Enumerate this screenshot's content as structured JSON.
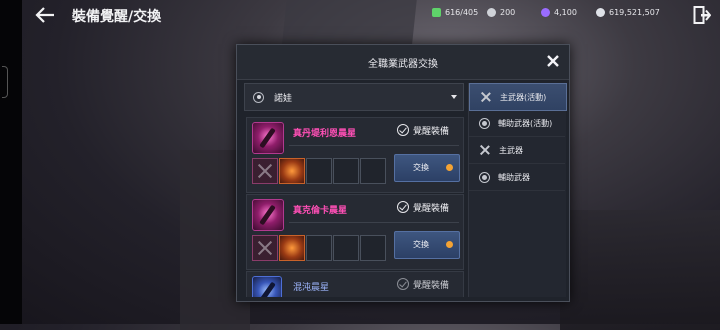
{
  "header": {
    "title": "裝備覺醒/交換"
  },
  "currencies": [
    {
      "icon": "green-gem-icon",
      "value": "616/405",
      "color": "#5fd36a"
    },
    {
      "icon": "silver-coin-icon",
      "value": "200",
      "color": "#cfd2d8"
    },
    {
      "icon": "purple-crystal-icon",
      "value": "4,100",
      "color": "#9a6cff"
    },
    {
      "icon": "silver-coin-icon",
      "value": "619,521,507",
      "color": "#dfe2e8"
    }
  ],
  "modal": {
    "title": "全職業武器交換",
    "character": "諾娃",
    "items": [
      {
        "name": "真丹堤利恩晨星",
        "status": "覺醒裝備",
        "button": "交換"
      },
      {
        "name": "真克倫卡晨星",
        "status": "覺醒裝備",
        "button": "交換"
      },
      {
        "name": "混沌晨星",
        "status": "覺醒裝備"
      }
    ],
    "categories": [
      {
        "label": "主武器(活動)",
        "icon": "crossed-swords-icon"
      },
      {
        "label": "輔助武器(活動)",
        "icon": "orb-icon"
      },
      {
        "label": "主武器",
        "icon": "crossed-swords-icon"
      },
      {
        "label": "輔助武器",
        "icon": "orb-icon"
      }
    ]
  },
  "colors": {
    "accent_button": "#2c4066",
    "notify_dot": "#f4a334",
    "legendary_name": "#ff4fb6",
    "rare_name": "#9fb7ff"
  }
}
